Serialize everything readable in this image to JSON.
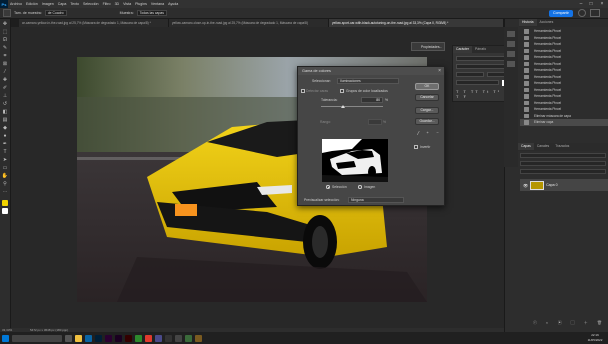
{
  "app": {
    "logo": "Ps"
  },
  "menu": [
    "Archivo",
    "Edición",
    "Imagen",
    "Capa",
    "Texto",
    "Selección",
    "Filtro",
    "3D",
    "Vista",
    "Plugins",
    "Ventana",
    "Ayuda"
  ],
  "options_bar": {
    "mode_label": "Tam. de muestra:",
    "mode_value": "5x5 de Cuadric",
    "mode_value_2": "de Cuadro",
    "sample_label": "Muestra:",
    "sample_value": "Todas las capas",
    "share_label": "Compartir"
  },
  "tabs": [
    "ar-camaro-yellow-in-the-road.jpg al 25,7% (Máscara de degradado 1, Máscara de capa/8) *",
    "yellow-camaro-close-up-in-the-road.jpg al 25,7% (Máscara de degradado 1, Máscara de capa/8)",
    "yellow-sport-car-with-black-autotuning-on-the-road.jpg al 33,3% (Capa 0, RGB/8) *"
  ],
  "context_popup": {
    "label": "Propiedades..."
  },
  "dialog": {
    "title": "Gama de colores",
    "select_label": "Seleccionar:",
    "select_value": "Iluminaciones",
    "detect_faces": "Detectar caras",
    "localized": "Grupos de color localizados",
    "tolerance_label": "Tolerancia:",
    "tolerance_value": "80",
    "tolerance_unit": "%",
    "range_label": "Rango:",
    "range_unit": "%",
    "ok": "OK",
    "cancel": "Cancelar",
    "load": "Cargar...",
    "save": "Guardar...",
    "invert": "Invertir",
    "preview_selection": "Selección",
    "preview_image": "Imagen",
    "preview_label": "Previsualizar selección:",
    "preview_value": "Ninguna"
  },
  "properties": {
    "tabs": [
      "Carácter",
      "Párrafo"
    ]
  },
  "history": {
    "tabs": [
      "Historia",
      "Acciones"
    ],
    "items": [
      "Herramienta Pincel",
      "Herramienta Pincel",
      "Herramienta Pincel",
      "Herramienta Pincel",
      "Herramienta Pincel",
      "Herramienta Pincel",
      "Herramienta Pincel",
      "Herramienta Pincel",
      "Herramienta Pincel",
      "Herramienta Pincel",
      "Herramienta Pincel",
      "Herramienta Pincel",
      "Herramienta Pincel",
      "Eliminar máscara de capa",
      "Eliminar capa"
    ]
  },
  "layers": {
    "tabs": [
      "Capas",
      "Canales",
      "Trazados"
    ],
    "row_label": "Capa 0"
  },
  "status": {
    "zoom": "33,33%",
    "doc": "5472 px x 3648 px (180 ppp)"
  },
  "clock": {
    "time": "22:16",
    "date": "11/05/2022"
  },
  "colors": {
    "accent": "#1473e6",
    "car_yellow": "#f2d400"
  }
}
